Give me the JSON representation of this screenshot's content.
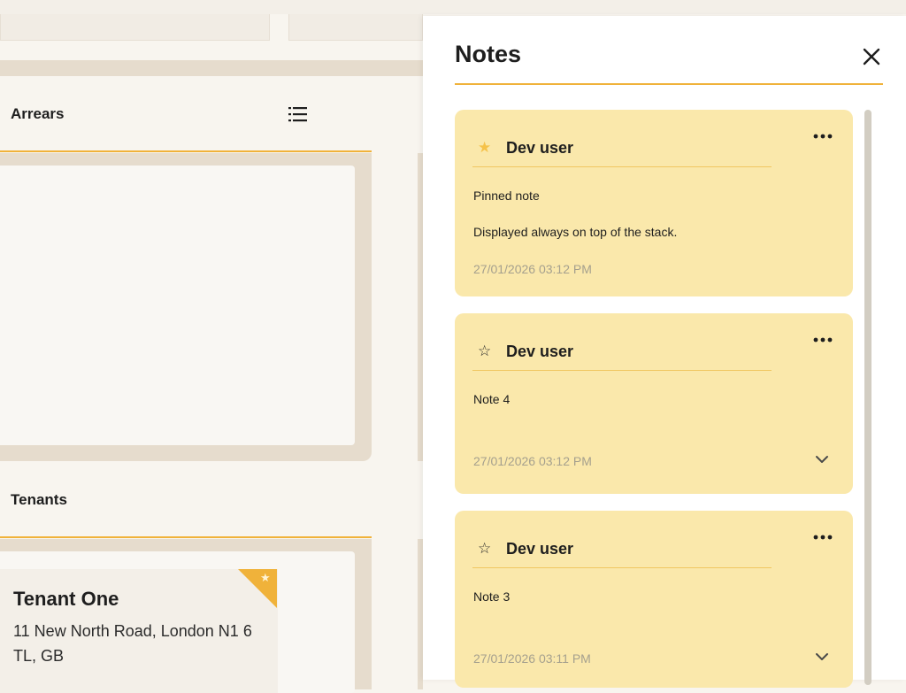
{
  "background": {
    "sections": [
      {
        "title": "Arrears",
        "icon": "list-icon"
      },
      {
        "title": "Tenants"
      }
    ],
    "tenant_card": {
      "name": "Tenant One",
      "address": "11 New North Road, London N1 6 TL, GB",
      "favorite": true
    }
  },
  "drawer": {
    "title": "Notes",
    "close_icon": "close-icon",
    "notes": [
      {
        "author": "Dev user",
        "pinned": true,
        "lines": [
          "Pinned note",
          "Displayed always on top of the stack."
        ],
        "timestamp": "27/01/2026 03:12 PM",
        "expandable": false
      },
      {
        "author": "Dev user",
        "pinned": false,
        "lines": [
          "Note 4"
        ],
        "timestamp": "27/01/2026 03:12 PM",
        "expandable": true
      },
      {
        "author": "Dev user",
        "pinned": false,
        "lines": [
          "Note 3"
        ],
        "timestamp": "27/01/2026 03:11 PM",
        "expandable": true
      }
    ]
  },
  "colors": {
    "accent": "#f0b23a",
    "note_background": "#fae8ab",
    "pinned_star": "#f5c24a",
    "timestamp": "#a5a08e"
  }
}
